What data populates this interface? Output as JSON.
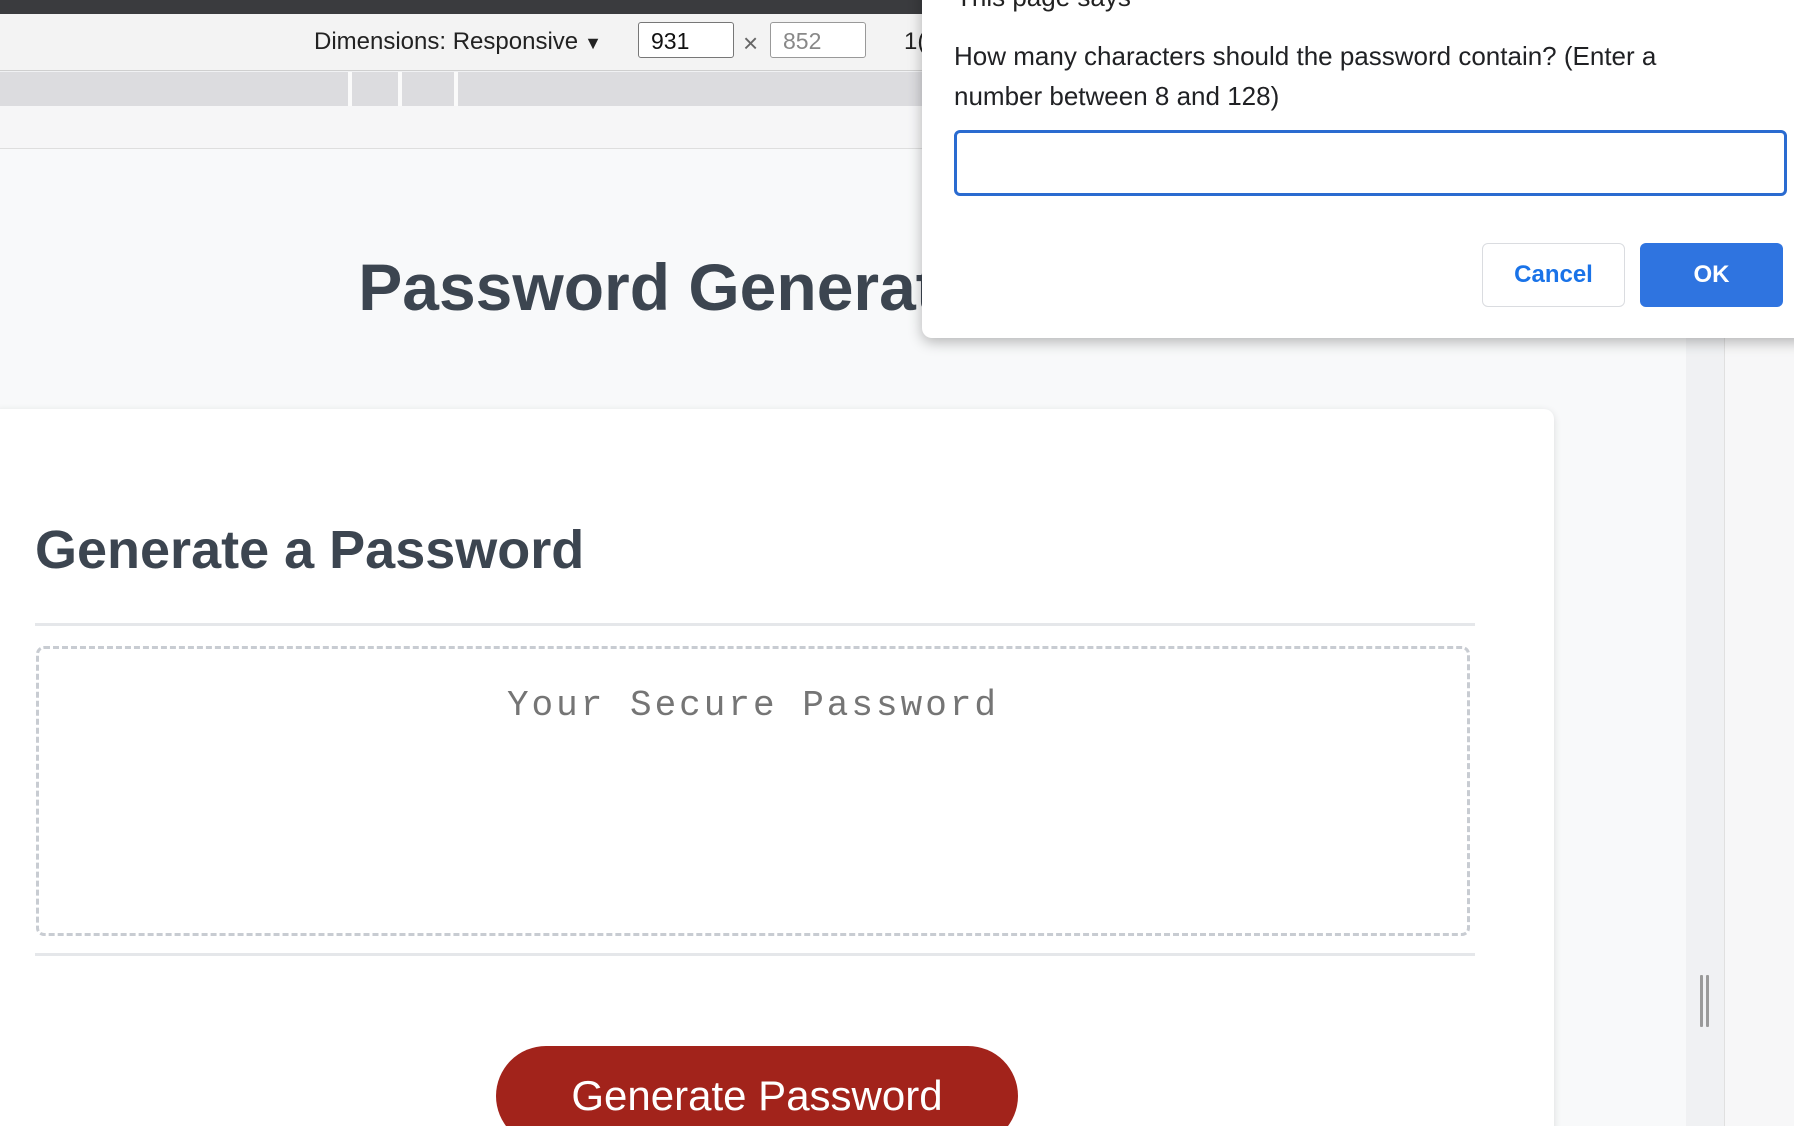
{
  "devtools": {
    "dimensions_label": "Dimensions: Responsive",
    "dropdown_arrow": "▼",
    "width_value": "931",
    "times_symbol": "×",
    "height_placeholder": "852",
    "zoom_text": "1("
  },
  "page": {
    "title": "Password Generator",
    "card_title": "Generate a Password",
    "password_placeholder": "Your Secure Password",
    "generate_button": "Generate Password"
  },
  "dialog": {
    "title": "This page says",
    "message": "How many characters should the password contain? (Enter a number between 8 and 128)",
    "input_value": "",
    "cancel_label": "Cancel",
    "ok_label": "OK"
  },
  "colors": {
    "primary_button": "#a2231b",
    "dialog_accent": "#2f74e0",
    "heading_text": "#3c4550"
  }
}
